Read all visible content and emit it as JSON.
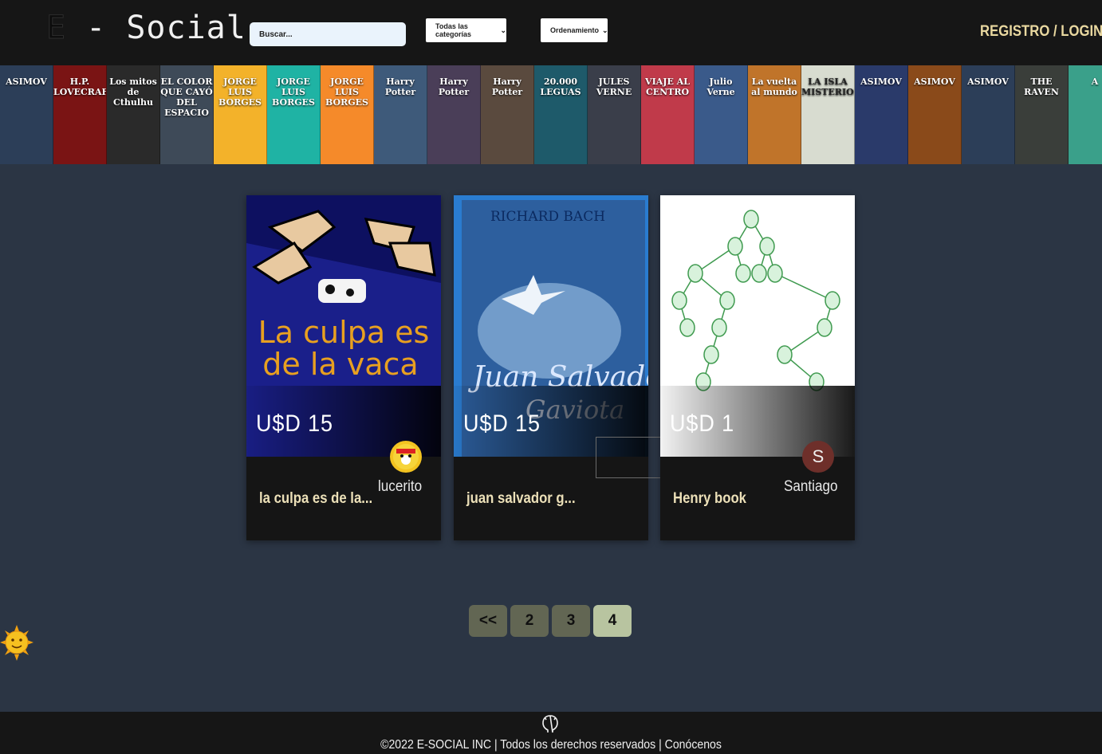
{
  "header": {
    "logo_e": "E",
    "logo_rest": " - Social",
    "search_placeholder": "Buscar...",
    "category_label": "Todas las categorías",
    "order_label": "Ordenamiento",
    "auth_label": "REGISTRO / LOGIN"
  },
  "banner": {
    "covers": [
      {
        "text": "ASIMOV",
        "color": "#2c3e58"
      },
      {
        "text": "H.P. LOVECRAFT",
        "color": "#7a1414"
      },
      {
        "text": "Los mitos de Cthulhu",
        "color": "#2a2a2a"
      },
      {
        "text": "EL COLOR QUE CAYÓ DEL ESPACIO",
        "color": "#3e4a58"
      },
      {
        "text": "JORGE LUIS BORGES",
        "color": "#f3b22a"
      },
      {
        "text": "JORGE LUIS BORGES",
        "color": "#1fb3a4"
      },
      {
        "text": "JORGE LUIS BORGES",
        "color": "#f58a2a"
      },
      {
        "text": "Harry Potter",
        "color": "#3e5a7a"
      },
      {
        "text": "Harry Potter",
        "color": "#4a3e58"
      },
      {
        "text": "Harry Potter",
        "color": "#5a4a3e"
      },
      {
        "text": "20.000 LEGUAS",
        "color": "#1e5a6a"
      },
      {
        "text": "JULES VERNE",
        "color": "#3a3e4a"
      },
      {
        "text": "VIAJE AL CENTRO",
        "color": "#c03a4a"
      },
      {
        "text": "Julio Verne",
        "color": "#3a5a8a"
      },
      {
        "text": "La vuelta al mundo",
        "color": "#c0742a"
      },
      {
        "text": "LA ISLA MISTERIOSA",
        "color": "#d8dcd0"
      },
      {
        "text": "ASIMOV",
        "color": "#2a3a6a"
      },
      {
        "text": "ASIMOV",
        "color": "#8a4a1a"
      },
      {
        "text": "ASIMOV",
        "color": "#2c3e58"
      },
      {
        "text": "THE RAVEN",
        "color": "#3a3e3a"
      },
      {
        "text": "A",
        "color": "#3aa08a"
      }
    ]
  },
  "cards": [
    {
      "price": "U$D 15",
      "title": "la culpa es de la...",
      "owner": "lucerito",
      "cover_text": "La culpa es de la vaca"
    },
    {
      "price": "U$D 15",
      "title": "juan salvador g...",
      "owner": "",
      "cover_text": "Juan Salvador Gaviota"
    },
    {
      "price": "U$D 1",
      "title": "Henry book",
      "owner": "Santiago",
      "avatar_letter": "S"
    }
  ],
  "pagination": {
    "prev": "<<",
    "pages": [
      "2",
      "3",
      "4"
    ],
    "active": "4"
  },
  "footer": {
    "copyright": "©2022 E-SOCIAL INC | Todos los derechos reservados | Conócenos"
  },
  "colors": {
    "background": "#2b3544",
    "header": "#161616",
    "accent": "#e9d8a0",
    "page_button": "#626653",
    "page_active": "#b8c4a0"
  }
}
